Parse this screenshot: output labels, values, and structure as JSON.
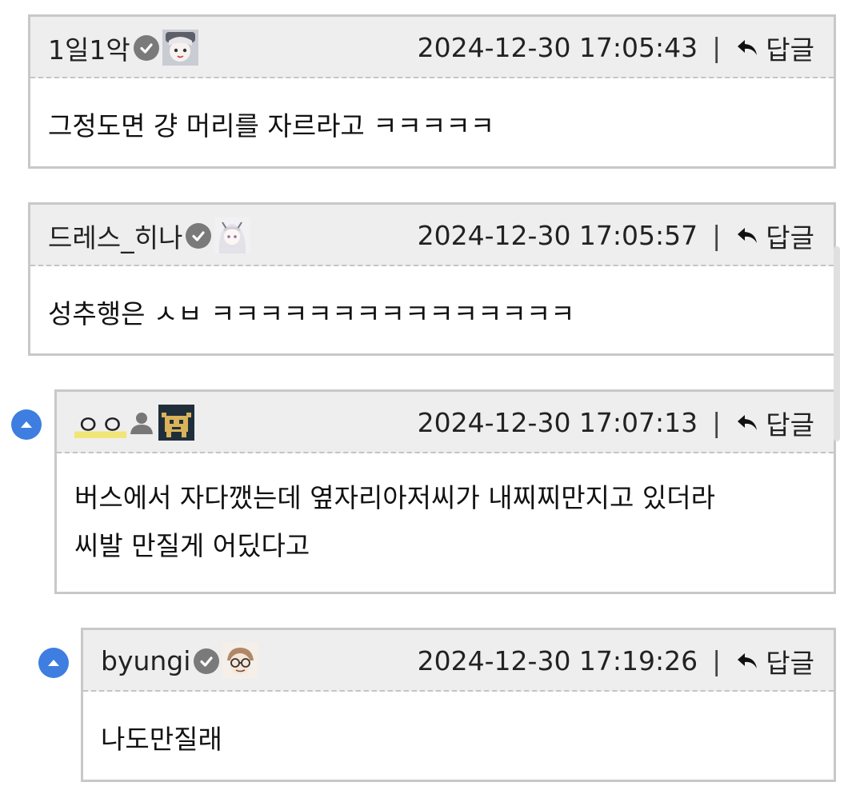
{
  "comments": [
    {
      "author": "1일1악",
      "verified": true,
      "datetime": "2024-12-30 17:05:43",
      "reply_label": "답글",
      "body": [
        "그정도면 걍 머리를 자르라고 ㅋㅋㅋㅋㅋ"
      ]
    },
    {
      "author": "드레스_히나",
      "verified": true,
      "datetime": "2024-12-30 17:05:57",
      "reply_label": "답글",
      "body": [
        "성추행은 ㅅㅂ ㅋㅋㅋㅋㅋㅋㅋㅋㅋㅋㅋㅋㅋㅋㅋ"
      ]
    },
    {
      "author": "ㅇㅇ",
      "verified": false,
      "datetime": "2024-12-30 17:07:13",
      "reply_label": "답글",
      "body": [
        "버스에서 자다깼는데 옆자리아저씨가 내찌찌만지고 있더라",
        "씨발 만질게 어딨다고"
      ]
    },
    {
      "author": "byungi",
      "verified": true,
      "datetime": "2024-12-30 17:19:26",
      "reply_label": "답글",
      "body": [
        "나도만질래"
      ]
    }
  ],
  "colors": {
    "header_bg": "#eeeeee",
    "border": "#c8c8c8",
    "accent_blue": "#3d7ee0",
    "verified_gray": "#7a7a7a",
    "name_highlight": "#f1e57a"
  },
  "icons": [
    "check-badge-icon",
    "user-icon",
    "reply-arrow-icon",
    "collapse-up-icon",
    "avatar-image"
  ]
}
